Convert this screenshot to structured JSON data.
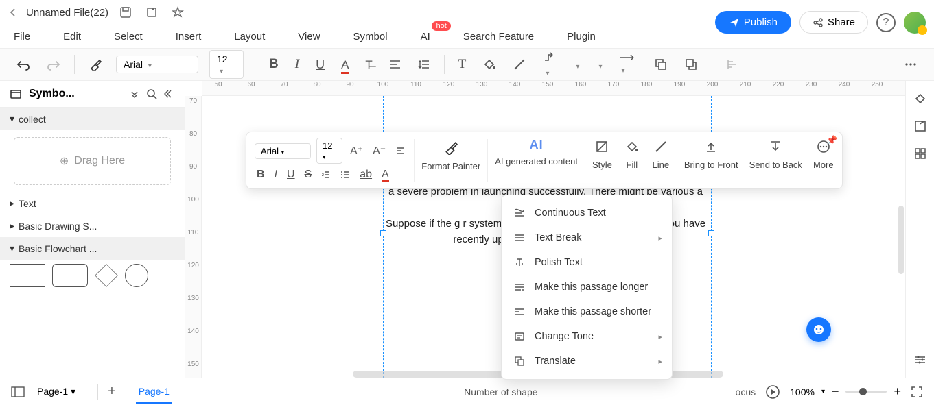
{
  "titlebar": {
    "filename": "Unnamed File(22)"
  },
  "menu": {
    "items": [
      "File",
      "Edit",
      "Select",
      "Insert",
      "Layout",
      "View",
      "Symbol",
      "AI",
      "Search Feature",
      "Plugin"
    ],
    "hot_badge": "hot",
    "publish": "Publish",
    "share": "Share"
  },
  "toolbar": {
    "font": "Arial",
    "size": "12"
  },
  "sidebar": {
    "title": "Symbo...",
    "sections": [
      "collect",
      "Text",
      "Basic Drawing S...",
      "Basic Flowchart ..."
    ],
    "drag": "Drag Here"
  },
  "ruler_h": [
    "50",
    "60",
    "70",
    "80",
    "90",
    "100",
    "110",
    "120",
    "130",
    "140",
    "150",
    "160",
    "170",
    "180",
    "190",
    "200",
    "210",
    "220",
    "230",
    "240",
    "250"
  ],
  "ruler_v": [
    "70",
    "80",
    "90",
    "100",
    "110",
    "120",
    "130",
    "140",
    "150"
  ],
  "text_content": {
    "p1": "a severe problem in launching successfully. There might be various                                             a",
    "p2": "Suppose if the g                                               r system are outdat                                        e is missing, then the U                                         you have recently upd                                      en you may need to ru                                    bility"
  },
  "float_tb": {
    "font": "Arial",
    "size": "12",
    "format_painter": "Format Painter",
    "ai_content": "AI generated content",
    "style": "Style",
    "fill": "Fill",
    "line": "Line",
    "bring_front": "Bring to Front",
    "send_back": "Send to Back",
    "more": "More"
  },
  "ctx": {
    "items": [
      "Continuous Text",
      "Text Break",
      "Polish Text",
      "Make this passage longer",
      "Make this passage shorter",
      "Change Tone",
      "Translate"
    ]
  },
  "bottom": {
    "page_select": "Page-1",
    "page_tab": "Page-1",
    "shapes": "Number of shape",
    "focus": "ocus",
    "zoom": "100%"
  }
}
